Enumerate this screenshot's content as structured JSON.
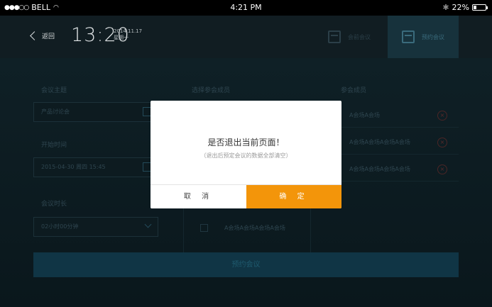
{
  "status_bar": {
    "carrier": "BELL",
    "time": "4:21 PM",
    "battery": "22%",
    "battery_level": 0.22
  },
  "header": {
    "back_label": "返回",
    "clock": "13:20",
    "date": "2014.11.17",
    "weekday": "星期一",
    "tabs": [
      {
        "label": "会前会议"
      },
      {
        "label": "预约会议"
      }
    ]
  },
  "form": {
    "topic_label": "会议主题",
    "topic_value": "产品讨论会",
    "start_label": "开始时间",
    "start_value": "2015-04-30   周四   15:45",
    "duration_label": "会议时长",
    "duration_value": "02小时00分钟",
    "select_members_label": "选择参会成员",
    "members_label": "参会成员",
    "candidate_item": "A会场A会场A会场A会场",
    "members": [
      {
        "name": "A会场A会场"
      },
      {
        "name": "A会场A会场A会场A会场"
      },
      {
        "name": "A会场A会场A会场A会场"
      }
    ],
    "submit_label": "预约会议"
  },
  "dialog": {
    "title": "是否退出当前页面！",
    "subtitle": "（退出后预定会议的数据全部清空）",
    "cancel_label": "取 消",
    "ok_label": "确 定"
  },
  "colors": {
    "accent": "#f3950a",
    "background": "#0a171c",
    "remove_icon": "#5a2a2a"
  }
}
